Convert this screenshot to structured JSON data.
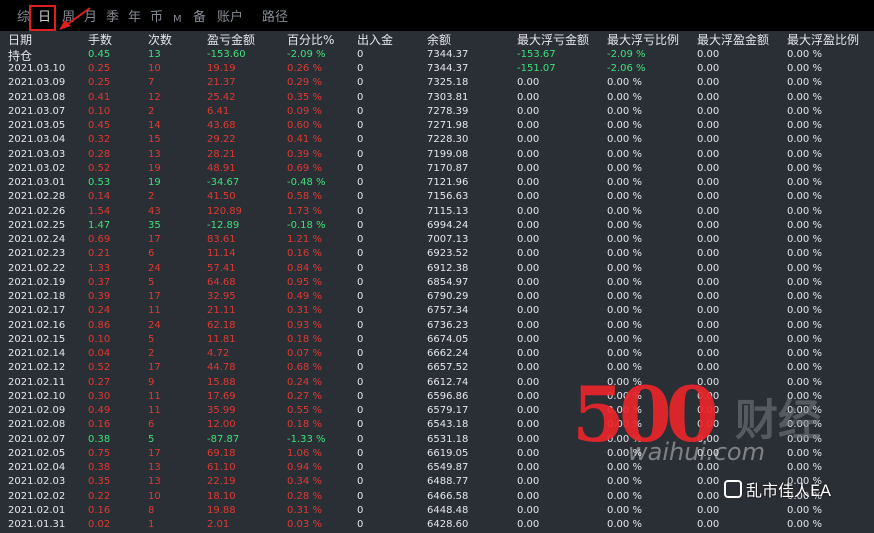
{
  "tabs": [
    "综",
    "日",
    "周",
    "月",
    "季",
    "年",
    "币",
    "M",
    "备",
    "账户",
    "路径"
  ],
  "active_tab": "日",
  "headers": [
    "日期",
    "手数",
    "次数",
    "盈亏金额",
    "百分比%",
    "出入金",
    "余额",
    "最大浮亏金额",
    "最大浮亏比例",
    "最大浮盈金额",
    "最大浮盈比例"
  ],
  "summary_label": "持仓",
  "summary": {
    "lots": "0.45",
    "count": "13",
    "pnl": "-153.60",
    "pct": "-2.09 %",
    "flow": "0",
    "balance": "7344.37",
    "maxdd_amt": "-153.67",
    "maxdd_pct": "-2.09 %",
    "maxfp_amt": "0.00",
    "maxfp_pct": "0.00 %",
    "sign": "neg"
  },
  "rows": [
    [
      "2021.03.10",
      "0.25",
      "10",
      "19.19",
      "0.26 %",
      "0",
      "7344.37",
      "-151.07",
      "-2.06 %",
      "0.00",
      "0.00 %",
      "pos"
    ],
    [
      "2021.03.09",
      "0.25",
      "7",
      "21.37",
      "0.29 %",
      "0",
      "7325.18",
      "0.00",
      "0.00 %",
      "0.00",
      "0.00 %",
      "pos"
    ],
    [
      "2021.03.08",
      "0.41",
      "12",
      "25.42",
      "0.35 %",
      "0",
      "7303.81",
      "0.00",
      "0.00 %",
      "0.00",
      "0.00 %",
      "pos"
    ],
    [
      "2021.03.07",
      "0.10",
      "2",
      "6.41",
      "0.09 %",
      "0",
      "7278.39",
      "0.00",
      "0.00 %",
      "0.00",
      "0.00 %",
      "pos"
    ],
    [
      "2021.03.05",
      "0.45",
      "14",
      "43.68",
      "0.60 %",
      "0",
      "7271.98",
      "0.00",
      "0.00 %",
      "0.00",
      "0.00 %",
      "pos"
    ],
    [
      "2021.03.04",
      "0.32",
      "15",
      "29.22",
      "0.41 %",
      "0",
      "7228.30",
      "0.00",
      "0.00 %",
      "0.00",
      "0.00 %",
      "pos"
    ],
    [
      "2021.03.03",
      "0.28",
      "13",
      "28.21",
      "0.39 %",
      "0",
      "7199.08",
      "0.00",
      "0.00 %",
      "0.00",
      "0.00 %",
      "pos"
    ],
    [
      "2021.03.02",
      "0.52",
      "19",
      "48.91",
      "0.69 %",
      "0",
      "7170.87",
      "0.00",
      "0.00 %",
      "0.00",
      "0.00 %",
      "pos"
    ],
    [
      "2021.03.01",
      "0.53",
      "19",
      "-34.67",
      "-0.48 %",
      "0",
      "7121.96",
      "0.00",
      "0.00 %",
      "0.00",
      "0.00 %",
      "neg"
    ],
    [
      "2021.02.28",
      "0.14",
      "2",
      "41.50",
      "0.58 %",
      "0",
      "7156.63",
      "0.00",
      "0.00 %",
      "0.00",
      "0.00 %",
      "pos"
    ],
    [
      "2021.02.26",
      "1.54",
      "43",
      "120.89",
      "1.73 %",
      "0",
      "7115.13",
      "0.00",
      "0.00 %",
      "0.00",
      "0.00 %",
      "pos"
    ],
    [
      "2021.02.25",
      "1.47",
      "35",
      "-12.89",
      "-0.18 %",
      "0",
      "6994.24",
      "0.00",
      "0.00 %",
      "0.00",
      "0.00 %",
      "neg"
    ],
    [
      "2021.02.24",
      "0.69",
      "17",
      "83.61",
      "1.21 %",
      "0",
      "7007.13",
      "0.00",
      "0.00 %",
      "0.00",
      "0.00 %",
      "pos"
    ],
    [
      "2021.02.23",
      "0.21",
      "6",
      "11.14",
      "0.16 %",
      "0",
      "6923.52",
      "0.00",
      "0.00 %",
      "0.00",
      "0.00 %",
      "pos"
    ],
    [
      "2021.02.22",
      "1.33",
      "24",
      "57.41",
      "0.84 %",
      "0",
      "6912.38",
      "0.00",
      "0.00 %",
      "0.00",
      "0.00 %",
      "pos"
    ],
    [
      "2021.02.19",
      "0.37",
      "5",
      "64.68",
      "0.95 %",
      "0",
      "6854.97",
      "0.00",
      "0.00 %",
      "0.00",
      "0.00 %",
      "pos"
    ],
    [
      "2021.02.18",
      "0.39",
      "17",
      "32.95",
      "0.49 %",
      "0",
      "6790.29",
      "0.00",
      "0.00 %",
      "0.00",
      "0.00 %",
      "pos"
    ],
    [
      "2021.02.17",
      "0.24",
      "11",
      "21.11",
      "0.31 %",
      "0",
      "6757.34",
      "0.00",
      "0.00 %",
      "0.00",
      "0.00 %",
      "pos"
    ],
    [
      "2021.02.16",
      "0.86",
      "24",
      "62.18",
      "0.93 %",
      "0",
      "6736.23",
      "0.00",
      "0.00 %",
      "0.00",
      "0.00 %",
      "pos"
    ],
    [
      "2021.02.15",
      "0.10",
      "5",
      "11.81",
      "0.18 %",
      "0",
      "6674.05",
      "0.00",
      "0.00 %",
      "0.00",
      "0.00 %",
      "pos"
    ],
    [
      "2021.02.14",
      "0.04",
      "2",
      "4.72",
      "0.07 %",
      "0",
      "6662.24",
      "0.00",
      "0.00 %",
      "0.00",
      "0.00 %",
      "pos"
    ],
    [
      "2021.02.12",
      "0.52",
      "17",
      "44.78",
      "0.68 %",
      "0",
      "6657.52",
      "0.00",
      "0.00 %",
      "0.00",
      "0.00 %",
      "pos"
    ],
    [
      "2021.02.11",
      "0.27",
      "9",
      "15.88",
      "0.24 %",
      "0",
      "6612.74",
      "0.00",
      "0.00 %",
      "0.00",
      "0.00 %",
      "pos"
    ],
    [
      "2021.02.10",
      "0.30",
      "11",
      "17.69",
      "0.27 %",
      "0",
      "6596.86",
      "0.00",
      "0.00 %",
      "0.00",
      "0.00 %",
      "pos"
    ],
    [
      "2021.02.09",
      "0.49",
      "11",
      "35.99",
      "0.55 %",
      "0",
      "6579.17",
      "0.00",
      "0.00 %",
      "0.00",
      "0.00 %",
      "pos"
    ],
    [
      "2021.02.08",
      "0.16",
      "6",
      "12.00",
      "0.18 %",
      "0",
      "6543.18",
      "0.00",
      "0.00 %",
      "0.00",
      "0.00 %",
      "pos"
    ],
    [
      "2021.02.07",
      "0.38",
      "5",
      "-87.87",
      "-1.33 %",
      "0",
      "6531.18",
      "0.00",
      "0.00 %",
      "0.00",
      "0.00 %",
      "neg"
    ],
    [
      "2021.02.05",
      "0.75",
      "17",
      "69.18",
      "1.06 %",
      "0",
      "6619.05",
      "0.00",
      "0.00 %",
      "0.00",
      "0.00 %",
      "pos"
    ],
    [
      "2021.02.04",
      "0.38",
      "13",
      "61.10",
      "0.94 %",
      "0",
      "6549.87",
      "0.00",
      "0.00 %",
      "0.00",
      "0.00 %",
      "pos"
    ],
    [
      "2021.02.03",
      "0.35",
      "13",
      "22.19",
      "0.34 %",
      "0",
      "6488.77",
      "0.00",
      "0.00 %",
      "0.00",
      "0.00 %",
      "pos"
    ],
    [
      "2021.02.02",
      "0.22",
      "10",
      "18.10",
      "0.28 %",
      "0",
      "6466.58",
      "0.00",
      "0.00 %",
      "0.00",
      "0.00 %",
      "pos"
    ],
    [
      "2021.02.01",
      "0.16",
      "8",
      "19.88",
      "0.31 %",
      "0",
      "6448.48",
      "0.00",
      "0.00 %",
      "0.00",
      "0.00 %",
      "pos"
    ],
    [
      "2021.01.31",
      "0.02",
      "1",
      "2.01",
      "0.03 %",
      "0",
      "6428.60",
      "0.00",
      "0.00 %",
      "0.00",
      "0.00 %",
      "pos"
    ]
  ],
  "watermark": {
    "number": "500",
    "cn": "财经",
    "url": "waihui.com",
    "user": "乱市佳人EA"
  },
  "colors": {
    "positive": "#e03a32",
    "negative": "#3ee07a",
    "neutral": "#e4e6ea",
    "highlight": "#e02020"
  }
}
